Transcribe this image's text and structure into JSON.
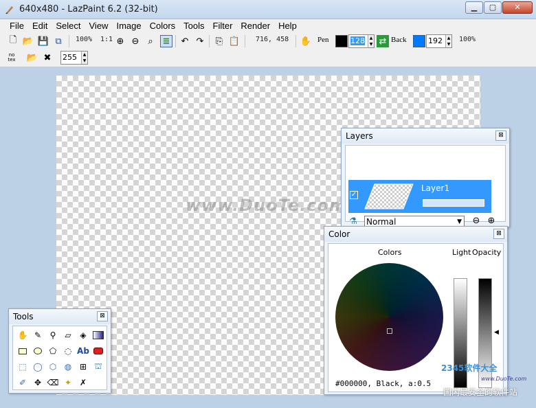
{
  "window": {
    "title": "640x480 - LazPaint 6.2 (32-bit)",
    "minimize_icon": "minimize-icon",
    "maximize_icon": "maximize-icon",
    "close_icon": "close-icon"
  },
  "menu": [
    "File",
    "Edit",
    "Select",
    "View",
    "Image",
    "Colors",
    "Tools",
    "Filter",
    "Render",
    "Help"
  ],
  "toolbar": {
    "zoom_percent": "100%",
    "zoom_one": "1:1",
    "coordinates": "716, 458",
    "pen_label": "Pen",
    "pen_color": "#000000",
    "pen_alpha": "128",
    "back_label": "Back",
    "back_color": "#0078ff",
    "back_alpha": "192",
    "opacity_percent": "100%",
    "no_tex_label": "no tex",
    "tolerance_value": "255"
  },
  "canvas": {
    "watermark": "www.DuoTe.com"
  },
  "layers_panel": {
    "title": "Layers",
    "layer_name": "Layer1",
    "layer_visible": true,
    "blend_mode": "Normal"
  },
  "color_panel": {
    "title": "Color",
    "colors_label": "Colors",
    "light_label": "Light",
    "opacity_label": "Opacity",
    "readout": "#000000, Black, a:0.5"
  },
  "tools_panel": {
    "title": "Tools"
  },
  "watermarks": {
    "brand": "2345软件大全",
    "url": "www.DuoTe.com",
    "chinese": "国内最安全的软件站"
  }
}
